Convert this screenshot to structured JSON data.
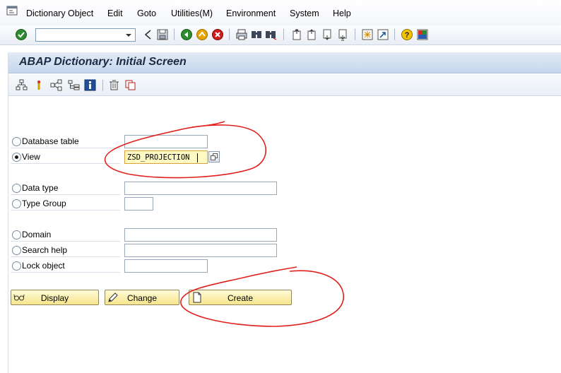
{
  "menu": {
    "items": [
      "Dictionary Object",
      "Edit",
      "Goto",
      "Utilities(M)",
      "Environment",
      "System",
      "Help"
    ]
  },
  "toolbar": {
    "command_value": "",
    "icons": [
      "enter-icon",
      "back-icon",
      "save-icon",
      "green-back-icon",
      "exit-icon",
      "cancel-icon",
      "print-icon",
      "find-icon",
      "find-next-icon",
      "first-page-icon",
      "previous-page-icon",
      "next-page-icon",
      "last-page-icon",
      "create-session-icon",
      "shortcut-icon",
      "help-icon",
      "layout-menu-icon"
    ]
  },
  "screen": {
    "title": "ABAP Dictionary: Initial Screen"
  },
  "appbar": {
    "icons": [
      "hierarchy-icon",
      "where-used-icon",
      "network-icon",
      "structure-icon",
      "info-icon",
      "delete-icon",
      "copy-icon"
    ]
  },
  "form": {
    "options": [
      {
        "label": "Database table",
        "selected": false,
        "value": ""
      },
      {
        "label": "View",
        "selected": true,
        "value": "ZSD_PROJECTION"
      },
      {
        "label": "Data type",
        "selected": false,
        "value": ""
      },
      {
        "label": "Type Group",
        "selected": false,
        "value": ""
      },
      {
        "label": "Domain",
        "selected": false,
        "value": ""
      },
      {
        "label": "Search help",
        "selected": false,
        "value": ""
      },
      {
        "label": "Lock object",
        "selected": false,
        "value": ""
      }
    ]
  },
  "buttons": {
    "display": "Display",
    "change": "Change",
    "create": "Create"
  },
  "colors": {
    "annotation": "#e0201c",
    "title_bar": "#c6d6ec",
    "button": "#f6e58c",
    "active_field": "#fff9c4"
  }
}
